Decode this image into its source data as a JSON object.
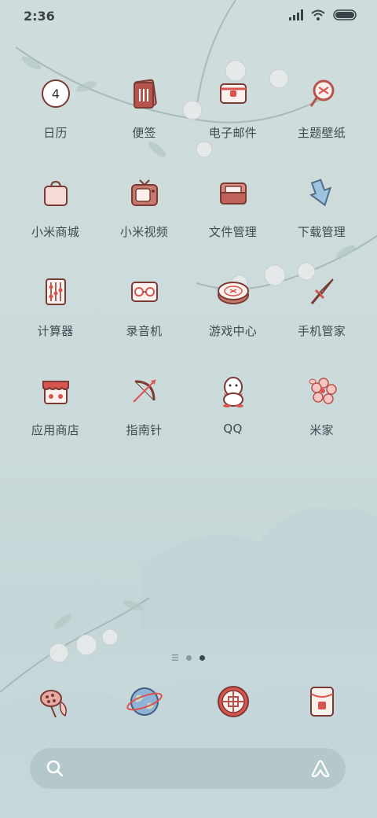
{
  "status": {
    "time": "2:36",
    "icons": [
      "signal-icon",
      "wifi-icon",
      "battery-icon"
    ]
  },
  "calendar_date": "4",
  "apps": [
    {
      "label": "日历",
      "icon": "calendar-icon"
    },
    {
      "label": "便签",
      "icon": "notes-icon"
    },
    {
      "label": "电子邮件",
      "icon": "email-icon"
    },
    {
      "label": "主题壁纸",
      "icon": "theme-fan-icon"
    },
    {
      "label": "小米商城",
      "icon": "shopping-bag-icon"
    },
    {
      "label": "小米视频",
      "icon": "tv-icon"
    },
    {
      "label": "文件管理",
      "icon": "folder-icon"
    },
    {
      "label": "下载管理",
      "icon": "download-arrow-icon"
    },
    {
      "label": "计算器",
      "icon": "abacus-icon"
    },
    {
      "label": "录音机",
      "icon": "cassette-icon"
    },
    {
      "label": "游戏中心",
      "icon": "xiangqi-piece-icon"
    },
    {
      "label": "手机管家",
      "icon": "sword-icon"
    },
    {
      "label": "应用商店",
      "icon": "shop-stall-icon"
    },
    {
      "label": "指南针",
      "icon": "bow-arrow-icon"
    },
    {
      "label": "QQ",
      "icon": "penguin-icon"
    },
    {
      "label": "米家",
      "icon": "blossom-icon"
    }
  ],
  "page_indicator": {
    "pages": 3,
    "current": 3
  },
  "dock": [
    {
      "icon": "lotus-pod-icon"
    },
    {
      "icon": "globe-icon"
    },
    {
      "icon": "window-lattice-icon"
    },
    {
      "icon": "message-card-icon"
    }
  ],
  "colors": {
    "background": "#cad9da",
    "icon_outline": "#7a3b34",
    "icon_fill": "#f5e4dc",
    "accent_red": "#d9534f",
    "label": "#414a50"
  }
}
